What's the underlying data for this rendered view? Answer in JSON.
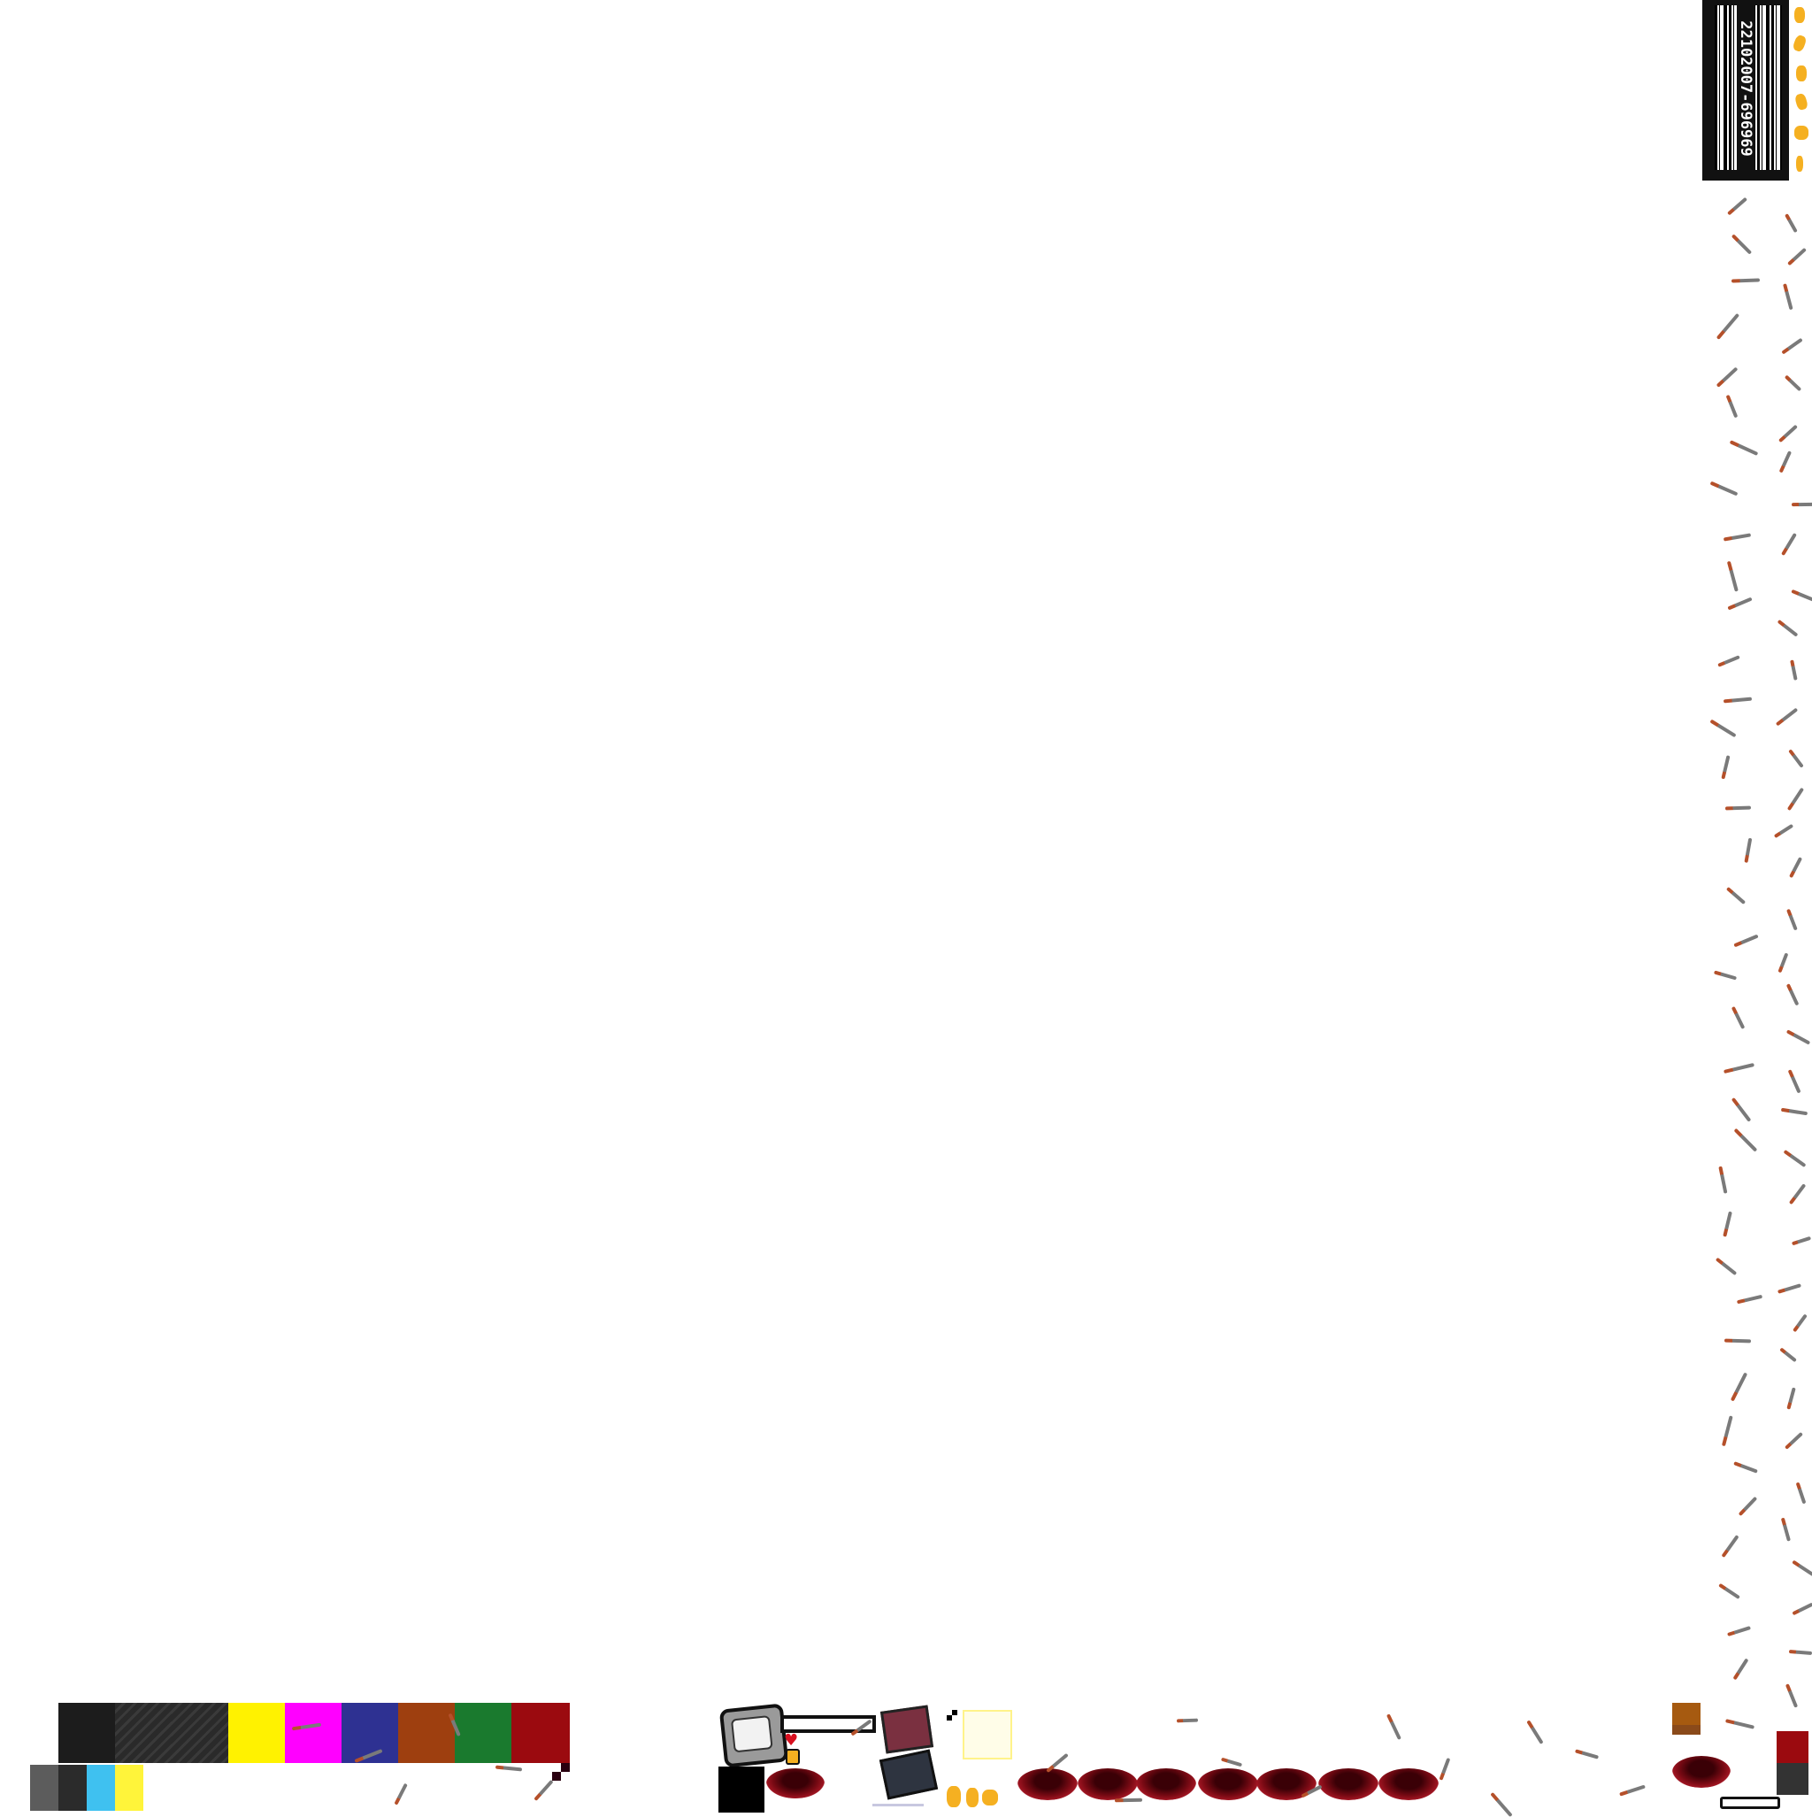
{
  "barcode": {
    "number": "22102007-696969"
  },
  "palette": {
    "top_row": [
      "#1c1c1c",
      "#1c1c1c",
      "hatch",
      "hatch",
      "#fff200",
      "#ff00ff",
      "#2e3192",
      "#9e3f0f",
      "#1a7a2e",
      "#9b0a0f"
    ],
    "bottom_row": [
      "#5c5c5c",
      "#2b2b2b",
      "#3fc1f0",
      "#fff43a"
    ]
  },
  "sprites": {
    "tv_head_icon": "tv-face-icon",
    "heart_icon": "heart-icon",
    "coin_icon": "coin-icon",
    "blood_pool_count": 8,
    "scrap_shard_icon": "scrap-shard-icon"
  },
  "colors": {
    "background": "#ffffff",
    "blood_dark": "#3a0006",
    "blood_red": "#9b0a0f",
    "gold": "#f5b021",
    "shard_rust": "#b5502a"
  }
}
